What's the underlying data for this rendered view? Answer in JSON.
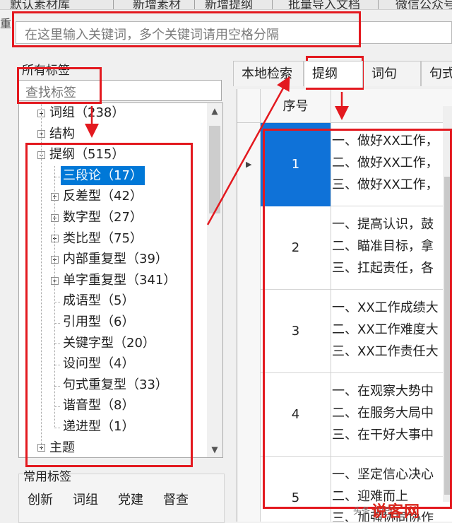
{
  "top_tabs": [
    "默认素材库",
    "新增素材",
    "新增提纲",
    "批量导入文档",
    "微信公众号"
  ],
  "side_marker": "重",
  "search": {
    "placeholder": "在这里输入关键词，多个关键词请用空格分隔"
  },
  "left_panel": {
    "title": "所有标签",
    "tag_search_placeholder": "查找标签",
    "tree": [
      {
        "label": "词组（238）",
        "level": 0,
        "expander": "plus"
      },
      {
        "label": "结构",
        "level": 0,
        "expander": "plus"
      },
      {
        "label": "提纲（515）",
        "level": 0,
        "expander": "minus"
      },
      {
        "label": "三段论（17）",
        "level": 1,
        "expander": "none",
        "selected": true
      },
      {
        "label": "反差型（42）",
        "level": 1,
        "expander": "plus"
      },
      {
        "label": "数字型（27）",
        "level": 1,
        "expander": "plus"
      },
      {
        "label": "类比型（75）",
        "level": 1,
        "expander": "plus"
      },
      {
        "label": "内部重复型（39）",
        "level": 1,
        "expander": "plus"
      },
      {
        "label": "单字重复型（341）",
        "level": 1,
        "expander": "plus"
      },
      {
        "label": "成语型（5）",
        "level": 1,
        "expander": "none"
      },
      {
        "label": "引用型（6）",
        "level": 1,
        "expander": "none"
      },
      {
        "label": "关键字型（20）",
        "level": 1,
        "expander": "none"
      },
      {
        "label": "设问型（4）",
        "level": 1,
        "expander": "none"
      },
      {
        "label": "句式重复型（33）",
        "level": 1,
        "expander": "none"
      },
      {
        "label": "谐音型（8）",
        "level": 1,
        "expander": "none"
      },
      {
        "label": "递进型（1）",
        "level": 1,
        "expander": "none"
      },
      {
        "label": "主题",
        "level": 0,
        "expander": "plus"
      }
    ],
    "common_title": "常用标签",
    "common_tags": [
      "创新",
      "词组",
      "党建",
      "督查"
    ]
  },
  "right_panel": {
    "tabs": [
      {
        "label": "本地检索"
      },
      {
        "label": "提纲",
        "active": true
      },
      {
        "label": "词句"
      },
      {
        "label": "句式"
      }
    ],
    "column_header": "序号",
    "rows": [
      {
        "num": "1",
        "selected": true,
        "lines": [
          "一、做好XX工作，",
          "二、做好XX工作，",
          "三、做好XX工作，"
        ]
      },
      {
        "num": "2",
        "lines": [
          "一、提高认识，鼓",
          "二、瞄准目标，拿",
          "三、扛起责任，各"
        ]
      },
      {
        "num": "3",
        "lines": [
          "一、XX工作成绩大",
          "二、XX工作难度大",
          "三、XX工作责任大"
        ]
      },
      {
        "num": "4",
        "lines": [
          "一、在观察大势中",
          "二、在服务大局中",
          "三、在干好大事中"
        ]
      },
      {
        "num": "5",
        "lines": [
          "一、坚定信心决心",
          "二、迎难而上",
          "三、加强协同协作"
        ]
      }
    ],
    "row_indicator": "▶"
  },
  "icons": {
    "scroll_up": "▲",
    "scroll_down": "▼"
  },
  "watermark": {
    "logo": "说客网",
    "sub": "头条 @职场..."
  },
  "colors": {
    "accent": "#0078d7",
    "annotation": "#e3191f"
  }
}
